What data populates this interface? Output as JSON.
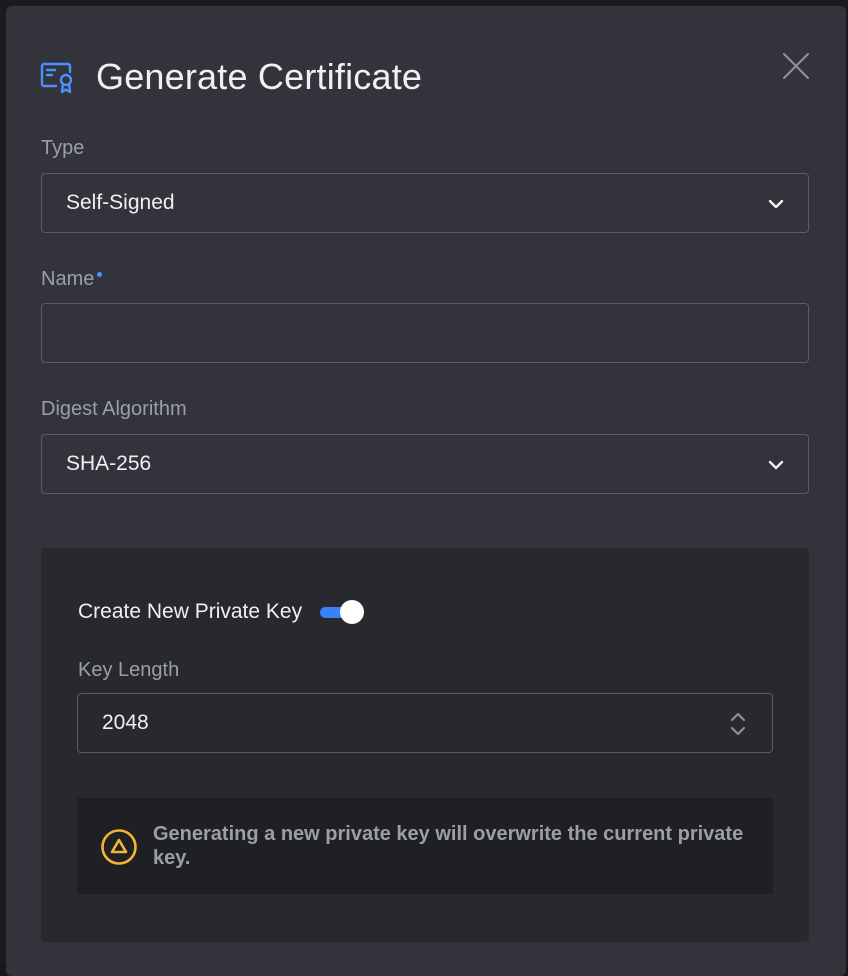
{
  "dialog": {
    "title": "Generate Certificate",
    "icon": "certificate-icon",
    "close_icon": "close-icon"
  },
  "form": {
    "type": {
      "label": "Type",
      "value": "Self-Signed"
    },
    "name": {
      "label": "Name",
      "value": "",
      "required": true
    },
    "digest": {
      "label": "Digest Algorithm",
      "value": "SHA-256"
    }
  },
  "private_key": {
    "toggle_label": "Create New Private Key",
    "toggle_on": true,
    "key_length_label": "Key Length",
    "key_length_value": "2048",
    "warning_icon": "warning-triangle-icon",
    "warning_text": "Generating a new private key will overwrite the current private key."
  },
  "colors": {
    "accent": "#3a82f7",
    "warning": "#f2b632",
    "modal_bg": "#33343b",
    "panel_bg": "#28292e"
  }
}
